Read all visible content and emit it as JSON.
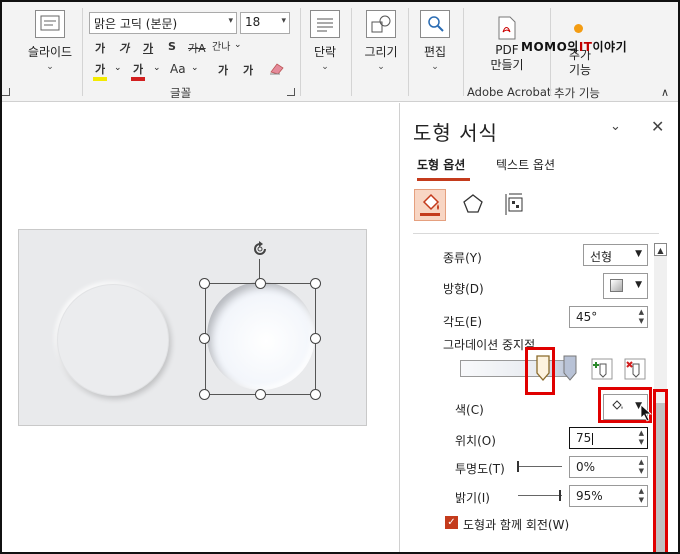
{
  "ribbon": {
    "slides": {
      "label": "슬라이드"
    },
    "font": {
      "name": "맑은 고딕 (본문)",
      "size": "18",
      "row2": [
        "가",
        "가",
        "가",
        "S",
        "가A",
        "간나"
      ],
      "row3": [
        "가",
        "가",
        "Aa",
        "가",
        "가"
      ],
      "group_label": "글꼴"
    },
    "paragraph": {
      "label": "단락"
    },
    "drawing": {
      "label": "그리기"
    },
    "editing": {
      "label": "편집"
    },
    "pdf": {
      "label_line1": "PDF",
      "label_line2": "만들기",
      "group_label": "Adobe Acrobat"
    },
    "addin": {
      "label_line1": "추가",
      "label_line2": "기능",
      "group_label": "추가 기능"
    },
    "watermark_left": "MOMO의",
    "watermark_it": "IT",
    "watermark_right": "이야기"
  },
  "pane": {
    "title": "도형 서식",
    "tabs": [
      "도형 옵션",
      "텍스트 옵션"
    ],
    "type": {
      "label": "종류(Y)",
      "value": "선형"
    },
    "direction": {
      "label": "방향(D)"
    },
    "angle": {
      "label": "각도(E)",
      "value": "45°"
    },
    "gradient_stops": {
      "label": "그라데이션 중지점"
    },
    "color": {
      "label": "색(C)"
    },
    "position": {
      "label": "위치(O)",
      "value": "75"
    },
    "transparency": {
      "label": "투명도(T)",
      "value": "0%",
      "level": 0.0
    },
    "brightness": {
      "label": "밝기(I)",
      "value": "95%",
      "level": 0.95
    },
    "rotate_with_shape": {
      "label": "도형과 함께 회전(W)",
      "checked": true
    }
  },
  "colors": {
    "accent": "#c43b1c",
    "highlight_red": "#e00000",
    "font_color_red": "#d21f1f",
    "highlight_yellow": "#f3ea00"
  }
}
